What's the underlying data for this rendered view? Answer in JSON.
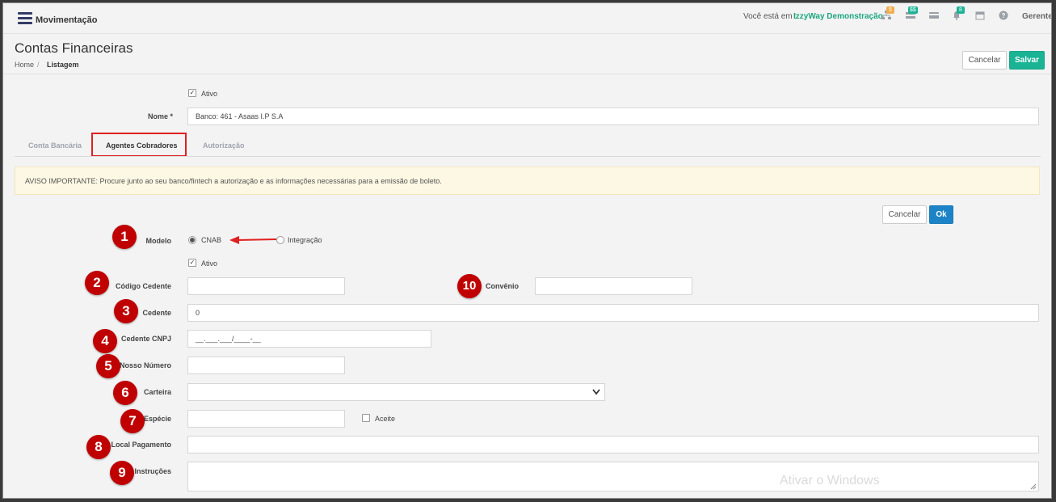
{
  "topbar": {
    "brand": "Movimentação",
    "location_label": "Você está em :",
    "location_value": "IzzyWay Demonstração",
    "badges": [
      "5",
      "$$",
      "8"
    ],
    "user": "Gerente",
    "icons": [
      "sitemap-icon",
      "money-icon",
      "card-icon",
      "bell-icon",
      "calendar-icon",
      "help-icon"
    ]
  },
  "header": {
    "title": "Contas Financeiras",
    "breadcrumb": {
      "home": "Home",
      "separator": "/",
      "current": "Listagem"
    },
    "cancel_label": "Cancelar",
    "save_label": "Salvar"
  },
  "form": {
    "ativo_label": "Ativo",
    "nome_label": "Nome *",
    "nome_value": "Banco: 461 - Asaas I.P S.A"
  },
  "tabs": [
    "Conta Bancária",
    "Agentes Cobradores",
    "Autorização"
  ],
  "alert": "AVISO IMPORTANTE: Procure junto ao seu banco/fintech a autorização e as informações necessárias para a emissão de boleto.",
  "agent": {
    "cancel_label": "Cancelar",
    "ok_label": "Ok",
    "modelo_label": "Modelo",
    "modelo_options": [
      "CNAB",
      "Integração"
    ],
    "modelo_selected": "CNAB",
    "ativo_label": "Ativo",
    "codigo_cedente_label": "Código Cedente",
    "codigo_cedente_value": "",
    "convenio_label": "Convênio",
    "convenio_value": "",
    "cedente_label": "Cedente",
    "cedente_value": "0",
    "cedente_cnpj_label": "Cedente CNPJ",
    "cedente_cnpj_value": "__.___.___/____-__",
    "nosso_numero_label": "Nosso Número",
    "nosso_numero_value": "",
    "carteira_label": "Carteira",
    "carteira_value": "",
    "especie_label": "Espécie",
    "especie_value": "",
    "aceite_label": "Aceite",
    "local_pagamento_label": "Local Pagamento",
    "local_pagamento_value": "",
    "instrucoes_label": "Instruções",
    "instrucoes_value": ""
  },
  "markers": [
    "1",
    "2",
    "3",
    "4",
    "5",
    "6",
    "7",
    "8",
    "9",
    "10"
  ],
  "colors": {
    "accent_green": "#1ab394",
    "ok_blue": "#1c84c6",
    "marker_red": "#c00000",
    "highlight_red": "#e02020"
  },
  "watermark": "Ativar o Windows"
}
